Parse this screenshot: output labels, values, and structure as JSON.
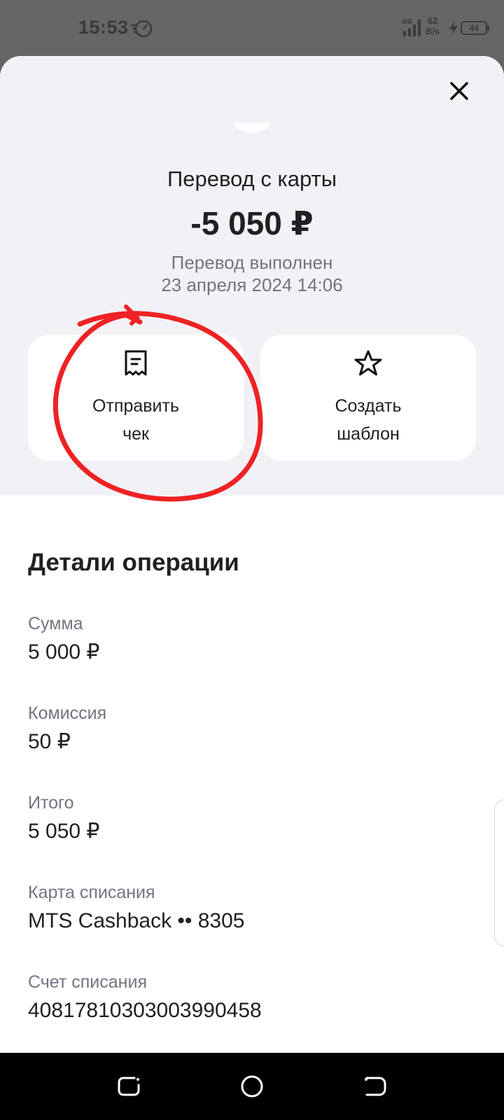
{
  "status_bar": {
    "time": "15:53",
    "network": "4G",
    "speed_value": "62",
    "speed_unit": "B/s",
    "battery": "44"
  },
  "sheet": {
    "close_icon": "close-icon",
    "title": "Перевод с карты",
    "amount": "-5 050 ₽",
    "status": "Перевод выполнен",
    "date": "23 апреля 2024 14:06"
  },
  "actions": {
    "send_receipt_label": "Отправить\nчек",
    "send_receipt_icon": "receipt-icon",
    "create_template_label": "Создать\nшаблон",
    "create_template_icon": "star-icon"
  },
  "details": {
    "title": "Детали операции",
    "items": [
      {
        "label": "Сумма",
        "value": "5 000 ₽"
      },
      {
        "label": "Комиссия",
        "value": "50 ₽"
      },
      {
        "label": "Итого",
        "value": "5 050 ₽"
      },
      {
        "label": "Карта списания",
        "value": "MTS Cashback •• 8305"
      },
      {
        "label": "Счет списания",
        "value": "40817810303003990458"
      }
    ]
  },
  "annotation": {
    "color": "#ee2224"
  },
  "colors": {
    "sheet_top_bg": "#f2f2f6",
    "text_primary": "#1f1f24",
    "text_secondary": "#737480"
  }
}
